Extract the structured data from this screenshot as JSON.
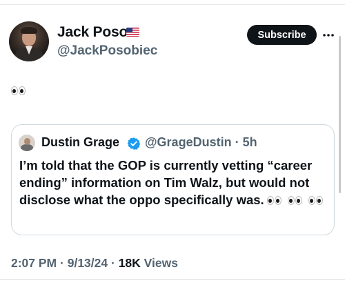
{
  "author": {
    "name": "Jack Poso",
    "flag": "US flag",
    "handle": "@JackPosobiec"
  },
  "header": {
    "subscribe_label": "Subscribe"
  },
  "post": {
    "text_emoji": "eyes"
  },
  "quoted": {
    "name": "Dustin Grage",
    "handle_time": "@GrageDustin · 5h",
    "text": "I’m told that the GOP is currently vetting “career ending” information on Tim Walz, but would not disclose what the oppo specifically was.",
    "trailing_emoji": [
      "eyes",
      "eyes",
      "eyes"
    ]
  },
  "meta": {
    "time": "2:07 PM",
    "date": "9/13/24",
    "views_count": "18K",
    "views_label": "Views"
  },
  "colors": {
    "text_primary": "#0f1419",
    "text_secondary": "#536471",
    "verified": "#1d9bf0",
    "border": "#cfd9de"
  }
}
